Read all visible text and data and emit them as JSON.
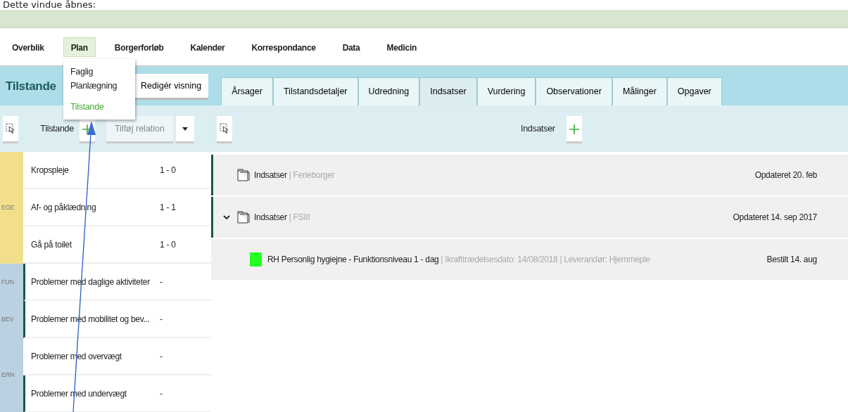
{
  "caption": "Dette vindue åbnes:",
  "nav": [
    {
      "label": "Overblik",
      "selected": false
    },
    {
      "label": "Plan",
      "selected": true
    },
    {
      "label": "Borgerforløb",
      "selected": false
    },
    {
      "label": "Kalender",
      "selected": false
    },
    {
      "label": "Korrespondance",
      "selected": false
    },
    {
      "label": "Data",
      "selected": false
    },
    {
      "label": "Medicin",
      "selected": false
    }
  ],
  "menu": {
    "items": [
      {
        "label": "Faglig Planlægning",
        "selected": false
      },
      {
        "label": "Tilstande",
        "selected": true
      }
    ]
  },
  "header": {
    "title": "Tilstande",
    "edit_button": "Redigér visning"
  },
  "tabs": [
    {
      "label": "Årsager",
      "selected": false
    },
    {
      "label": "Tilstandsdetaljer",
      "selected": false
    },
    {
      "label": "Udredning",
      "selected": false
    },
    {
      "label": "Indsatser",
      "selected": true
    },
    {
      "label": "Vurdering",
      "selected": false
    },
    {
      "label": "Observationer",
      "selected": false
    },
    {
      "label": "Målinger",
      "selected": false
    },
    {
      "label": "Opgaver",
      "selected": false
    }
  ],
  "left_toolbar": {
    "label": "Tilstande",
    "relation_button": "Tilføj relation"
  },
  "right_toolbar": {
    "label": "Indsatser"
  },
  "groups": [
    {
      "code": "EGE",
      "color": "#f2df8c",
      "rows": [
        {
          "name": "Kropspleje",
          "value": "1 - 0",
          "marked": false
        },
        {
          "name": "Af- og påklædning",
          "value": "1 - 1",
          "marked": false
        },
        {
          "name": "Gå på toilet",
          "value": "1 - 0",
          "marked": false
        }
      ]
    },
    {
      "code": "FUN",
      "color": "#b9d1e1",
      "rows": [
        {
          "name": "Problemer med daglige aktiviteter",
          "value": "-",
          "marked": true
        }
      ]
    },
    {
      "code": "BEV",
      "color": "#b9d1e1",
      "rows": [
        {
          "name": "Problemer med mobilitet og bev...",
          "value": "-",
          "marked": true
        }
      ]
    },
    {
      "code": "ERN",
      "color": "#b9d1e1",
      "rows": [
        {
          "name": "Problemer med overvægt",
          "value": "-",
          "marked": false
        },
        {
          "name": "Problemer med undervægt",
          "value": "-",
          "marked": true
        }
      ]
    }
  ],
  "entries": [
    {
      "kind": "folder",
      "title": "Indsatser",
      "source": "| Ferieborger",
      "updated": "Opdateret 20. feb",
      "marked": true,
      "expanded": false
    },
    {
      "kind": "folder",
      "title": "Indsatser",
      "source": "| FSIII",
      "updated": "Opdateret 14. sep 2017",
      "marked": true,
      "expanded": true
    },
    {
      "kind": "item",
      "color": "#22ff22",
      "title": "RH Personlig hygiejne - Funktionsniveau 1 - dag",
      "details": "| Ikrafttrædelsesdato: 14/08/2018 | Leverandør: Hjemmeple",
      "updated": "Bestilt 14. aug",
      "marked": false
    }
  ]
}
